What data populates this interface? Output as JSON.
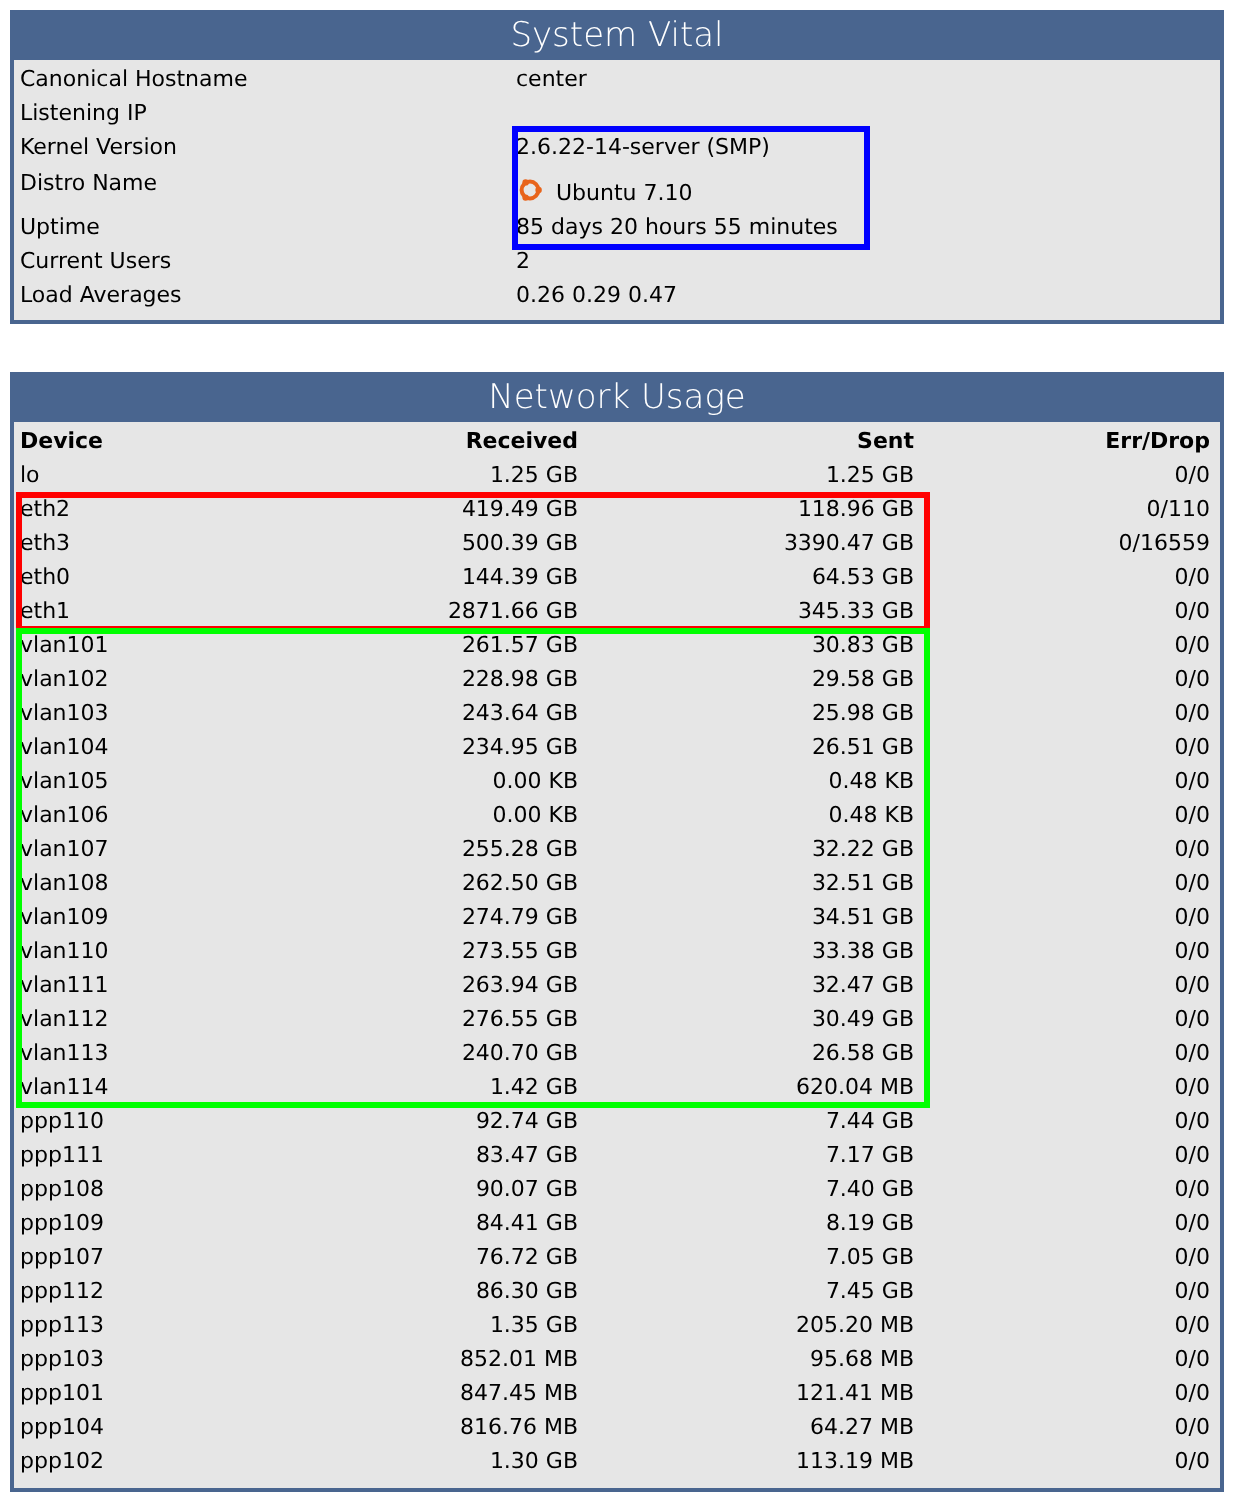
{
  "system_vital": {
    "title": "System Vital",
    "groups": [
      {
        "rows": [
          {
            "label": "Canonical Hostname",
            "value": "center"
          },
          {
            "label": "Listening IP"
          }
        ]
      },
      {
        "color": "#0000ff",
        "rows": [
          {
            "label": "Kernel Version",
            "value": "2.6.22-14-server (SMP)"
          },
          {
            "label": "Distro Name",
            "value": "Ubuntu 7.10",
            "kind": "with_logo"
          },
          {
            "label": "Uptime",
            "value": "85 days 20 hours 55 minutes"
          }
        ]
      },
      {
        "rows": [
          {
            "label": "Current Users",
            "value": "2"
          },
          {
            "label": "Load Averages",
            "value": "0.26 0.29 0.47"
          }
        ]
      }
    ]
  },
  "network_usage": {
    "title": "Network Usage",
    "columns": [
      "Device",
      "Received",
      "Sent",
      "Err/Drop"
    ],
    "groups": [
      {
        "rows": [
          [
            "lo",
            "1.25 GB",
            "1.25 GB",
            "0/0"
          ]
        ]
      },
      {
        "color": "#ff0000",
        "rows": [
          [
            "eth2",
            "419.49 GB",
            "118.96 GB",
            "0/110"
          ],
          [
            "eth3",
            "500.39 GB",
            "3390.47 GB",
            "0/16559"
          ],
          [
            "eth0",
            "144.39 GB",
            "64.53 GB",
            "0/0"
          ],
          [
            "eth1",
            "2871.66 GB",
            "345.33 GB",
            "0/0"
          ]
        ]
      },
      {
        "color": "#00ff00",
        "rows": [
          [
            "vlan101",
            "261.57 GB",
            "30.83 GB",
            "0/0"
          ],
          [
            "vlan102",
            "228.98 GB",
            "29.58 GB",
            "0/0"
          ],
          [
            "vlan103",
            "243.64 GB",
            "25.98 GB",
            "0/0"
          ],
          [
            "vlan104",
            "234.95 GB",
            "26.51 GB",
            "0/0"
          ],
          [
            "vlan105",
            "0.00 KB",
            "0.48 KB",
            "0/0"
          ],
          [
            "vlan106",
            "0.00 KB",
            "0.48 KB",
            "0/0"
          ],
          [
            "vlan107",
            "255.28 GB",
            "32.22 GB",
            "0/0"
          ],
          [
            "vlan108",
            "262.50 GB",
            "32.51 GB",
            "0/0"
          ],
          [
            "vlan109",
            "274.79 GB",
            "34.51 GB",
            "0/0"
          ],
          [
            "vlan110",
            "273.55 GB",
            "33.38 GB",
            "0/0"
          ],
          [
            "vlan111",
            "263.94 GB",
            "32.47 GB",
            "0/0"
          ],
          [
            "vlan112",
            "276.55 GB",
            "30.49 GB",
            "0/0"
          ],
          [
            "vlan113",
            "240.70 GB",
            "26.58 GB",
            "0/0"
          ],
          [
            "vlan114",
            "1.42 GB",
            "620.04 MB",
            "0/0"
          ]
        ]
      },
      {
        "rows": [
          [
            "ppp110",
            "92.74 GB",
            "7.44 GB",
            "0/0"
          ],
          [
            "ppp111",
            "83.47 GB",
            "7.17 GB",
            "0/0"
          ],
          [
            "ppp108",
            "90.07 GB",
            "7.40 GB",
            "0/0"
          ],
          [
            "ppp109",
            "84.41 GB",
            "8.19 GB",
            "0/0"
          ],
          [
            "ppp107",
            "76.72 GB",
            "7.05 GB",
            "0/0"
          ],
          [
            "ppp112",
            "86.30 GB",
            "7.45 GB",
            "0/0"
          ],
          [
            "ppp113",
            "1.35 GB",
            "205.20 MB",
            "0/0"
          ],
          [
            "ppp103",
            "852.01 MB",
            "95.68 MB",
            "0/0"
          ],
          [
            "ppp101",
            "847.45 MB",
            "121.41 MB",
            "0/0"
          ],
          [
            "ppp104",
            "816.76 MB",
            "64.27 MB",
            "0/0"
          ],
          [
            "ppp102",
            "1.30 GB",
            "113.19 MB",
            "0/0"
          ]
        ]
      }
    ]
  }
}
